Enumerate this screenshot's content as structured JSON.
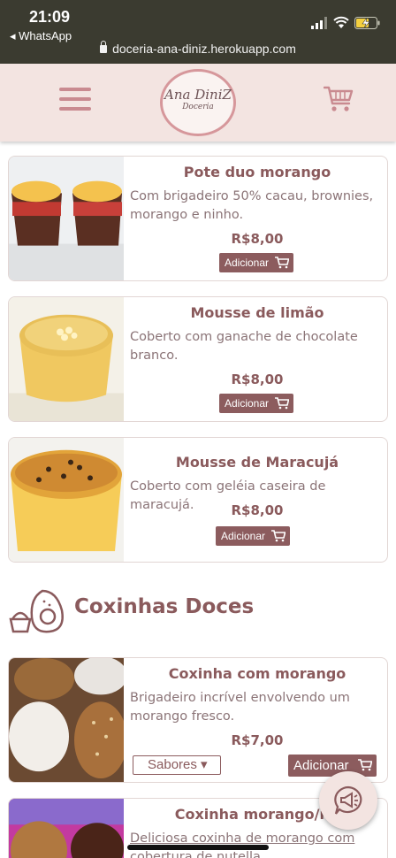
{
  "status_bar": {
    "time": "21:09",
    "back_app": "◂ WhatsApp",
    "url": "doceria-ana-diniz.herokuapp.com"
  },
  "header": {
    "logo_line1": "Ana DiniZ",
    "logo_line2": "Doceria",
    "menu_icon": "hamburger-icon",
    "cart_icon": "shopping-cart-icon"
  },
  "products": [
    {
      "name": "Pote duo morango",
      "description": "Com brigadeiro 50% cacau, brownies, morango e ninho.",
      "price": "R$8,00",
      "button": "Adicionar"
    },
    {
      "name": "Mousse de limão",
      "description": "Coberto com ganache de chocolate branco.",
      "price": "R$8,00",
      "button": "Adicionar"
    },
    {
      "name": "Mousse de Maracujá",
      "description": "Coberto com geléia caseira de maracujá.",
      "price": "R$8,00",
      "button": "Adicionar"
    }
  ],
  "section": {
    "title": "Coxinhas Doces",
    "icon": "coxinha-icon"
  },
  "coxinhas": [
    {
      "name": "Coxinha com morango",
      "description": "Brigadeiro incrível envolvendo um morango fresco.",
      "price": "R$7,00",
      "select": "Sabores ▾",
      "button": "Adicionar"
    },
    {
      "name": "Coxinha morango/nu",
      "description": "Deliciosa coxinha de morango com cobertura de nutella"
    }
  ],
  "colors": {
    "brand": "#8c5c5e",
    "header_bg": "#f3e4e1",
    "accent": "#c98a90"
  }
}
